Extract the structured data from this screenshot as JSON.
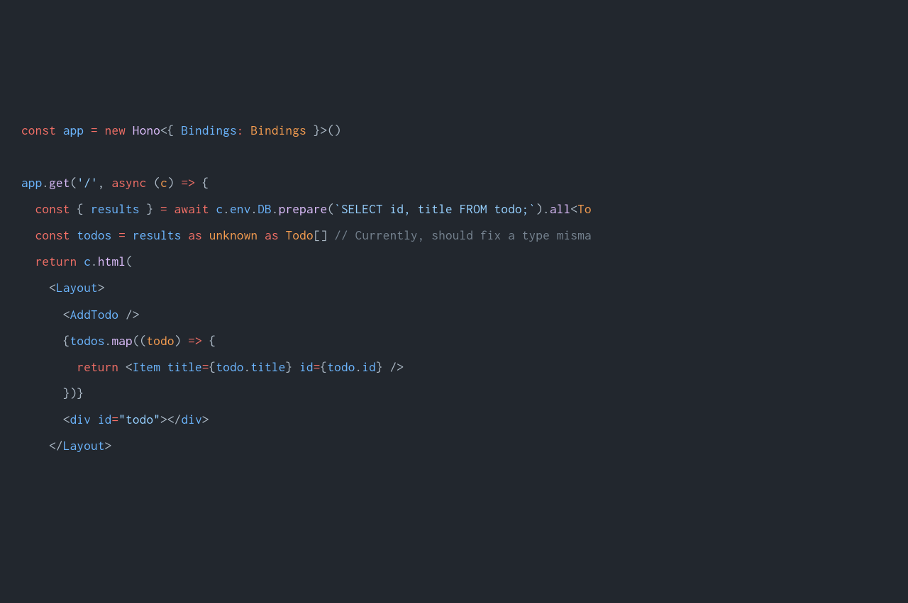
{
  "code": {
    "l1": {
      "t1": "const",
      "t2": "app",
      "t3": "=",
      "t4": "new",
      "t5": "Hono",
      "t6": "<{ ",
      "t7": "Bindings",
      "t8": ": ",
      "t9": "Bindings",
      "t10": " }>()"
    },
    "l2": "",
    "l3": {
      "t1": "app",
      "t2": ".",
      "t3": "get",
      "t4": "(",
      "t5": "'/'",
      "t6": ", ",
      "t7": "async",
      "t8": " (",
      "t9": "c",
      "t10": ") ",
      "t11": "=>",
      "t12": " {"
    },
    "l4": {
      "indent": "  ",
      "t1": "const",
      "t2": " { ",
      "t3": "results",
      "t4": " } ",
      "t5": "=",
      "t6": " ",
      "t7": "await",
      "t8": " ",
      "t9": "c",
      "t10": ".",
      "t11": "env",
      "t12": ".",
      "t13": "DB",
      "t14": ".",
      "t15": "prepare",
      "t16": "(",
      "t17": "`SELECT id, title FROM todo;`",
      "t18": ").",
      "t19": "all",
      "t20": "<",
      "t21": "To"
    },
    "l5": {
      "indent": "  ",
      "t1": "const",
      "t2": " ",
      "t3": "todos",
      "t4": " ",
      "t5": "=",
      "t6": " ",
      "t7": "results",
      "t8": " ",
      "t9": "as",
      "t10": " ",
      "t11": "unknown",
      "t12": " ",
      "t13": "as",
      "t14": " ",
      "t15": "Todo",
      "t16": "[] ",
      "t17": "// Currently, should fix a type misma"
    },
    "l6": {
      "indent": "  ",
      "t1": "return",
      "t2": " ",
      "t3": "c",
      "t4": ".",
      "t5": "html",
      "t6": "("
    },
    "l7": {
      "indent": "    ",
      "t1": "<",
      "t2": "Layout",
      "t3": ">"
    },
    "l8": {
      "indent": "      ",
      "t1": "<",
      "t2": "AddTodo",
      "t3": " />"
    },
    "l9": {
      "indent": "      ",
      "t1": "{",
      "t2": "todos",
      "t3": ".",
      "t4": "map",
      "t5": "((",
      "t6": "todo",
      "t7": ") ",
      "t8": "=>",
      "t9": " {"
    },
    "l10": {
      "indent": "        ",
      "t1": "return",
      "t2": " <",
      "t3": "Item",
      "t4": " ",
      "t5": "title",
      "t6": "=",
      "t7": "{",
      "t8": "todo",
      "t9": ".",
      "t10": "title",
      "t11": "} ",
      "t12": "id",
      "t13": "=",
      "t14": "{",
      "t15": "todo",
      "t16": ".",
      "t17": "id",
      "t18": "} />"
    },
    "l11": {
      "indent": "      ",
      "t1": "})}"
    },
    "l12": {
      "indent": "      ",
      "t1": "<",
      "t2": "div",
      "t3": " ",
      "t4": "id",
      "t5": "=",
      "t6": "\"todo\"",
      "t7": "></",
      "t8": "div",
      "t9": ">"
    },
    "l13": {
      "indent": "    ",
      "t1": "</",
      "t2": "Layout",
      "t3": ">"
    }
  }
}
